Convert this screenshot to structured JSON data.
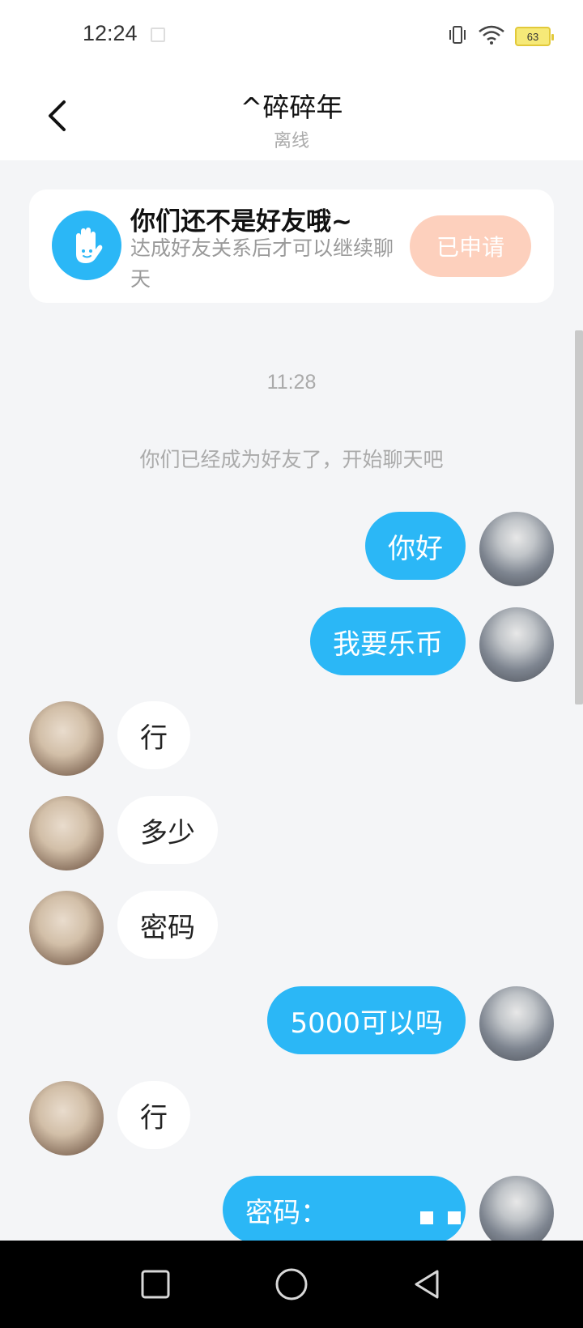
{
  "status_bar": {
    "time": "12:24",
    "battery_level": "63",
    "icons": [
      "notification-icon",
      "vibrate-icon",
      "wifi-icon",
      "battery-icon"
    ]
  },
  "header": {
    "title": "^碎碎年",
    "subtitle": "离线",
    "back_icon": "chevron-left-icon"
  },
  "notice": {
    "icon": "waving-hand-icon",
    "title": "你们还不是好友哦~",
    "description": "达成好友关系后才可以继续聊天",
    "button_label": "已申请"
  },
  "chat": {
    "timestamp": "11:28",
    "system_message": "你们已经成为好友了，开始聊天吧",
    "messages": [
      {
        "side": "right",
        "text": "你好"
      },
      {
        "side": "right",
        "text": "我要乐币"
      },
      {
        "side": "left",
        "text": "行"
      },
      {
        "side": "left",
        "text": "多少"
      },
      {
        "side": "left",
        "text": "密码"
      },
      {
        "side": "right",
        "text": "5000可以吗"
      },
      {
        "side": "left",
        "text": "行"
      },
      {
        "side": "right",
        "text": "密码："
      }
    ]
  },
  "nav_bar": {
    "buttons": [
      "recents-icon",
      "home-icon",
      "back-triangle-icon"
    ]
  },
  "colors": {
    "accent_blue": "#2bb7f6",
    "apply_button": "#fdd0bd",
    "background": "#f4f5f7"
  }
}
